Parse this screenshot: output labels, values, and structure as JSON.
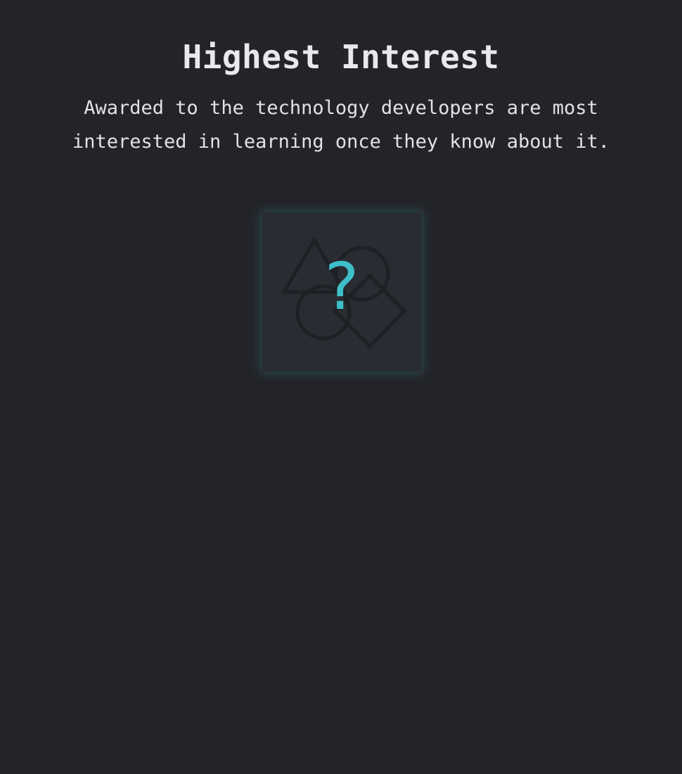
{
  "award": {
    "title": "Highest Interest",
    "description": "Awarded to the technology developers are most interested in learning once they know about it.",
    "placeholder_glyph": "?",
    "placeholder_icon": "shapes-icon"
  },
  "colors": {
    "background": "#232429",
    "tile": "#292c33",
    "accent": "#3ebfc9",
    "shape_outline": "#1f2024",
    "text": "#e9e9eb"
  }
}
